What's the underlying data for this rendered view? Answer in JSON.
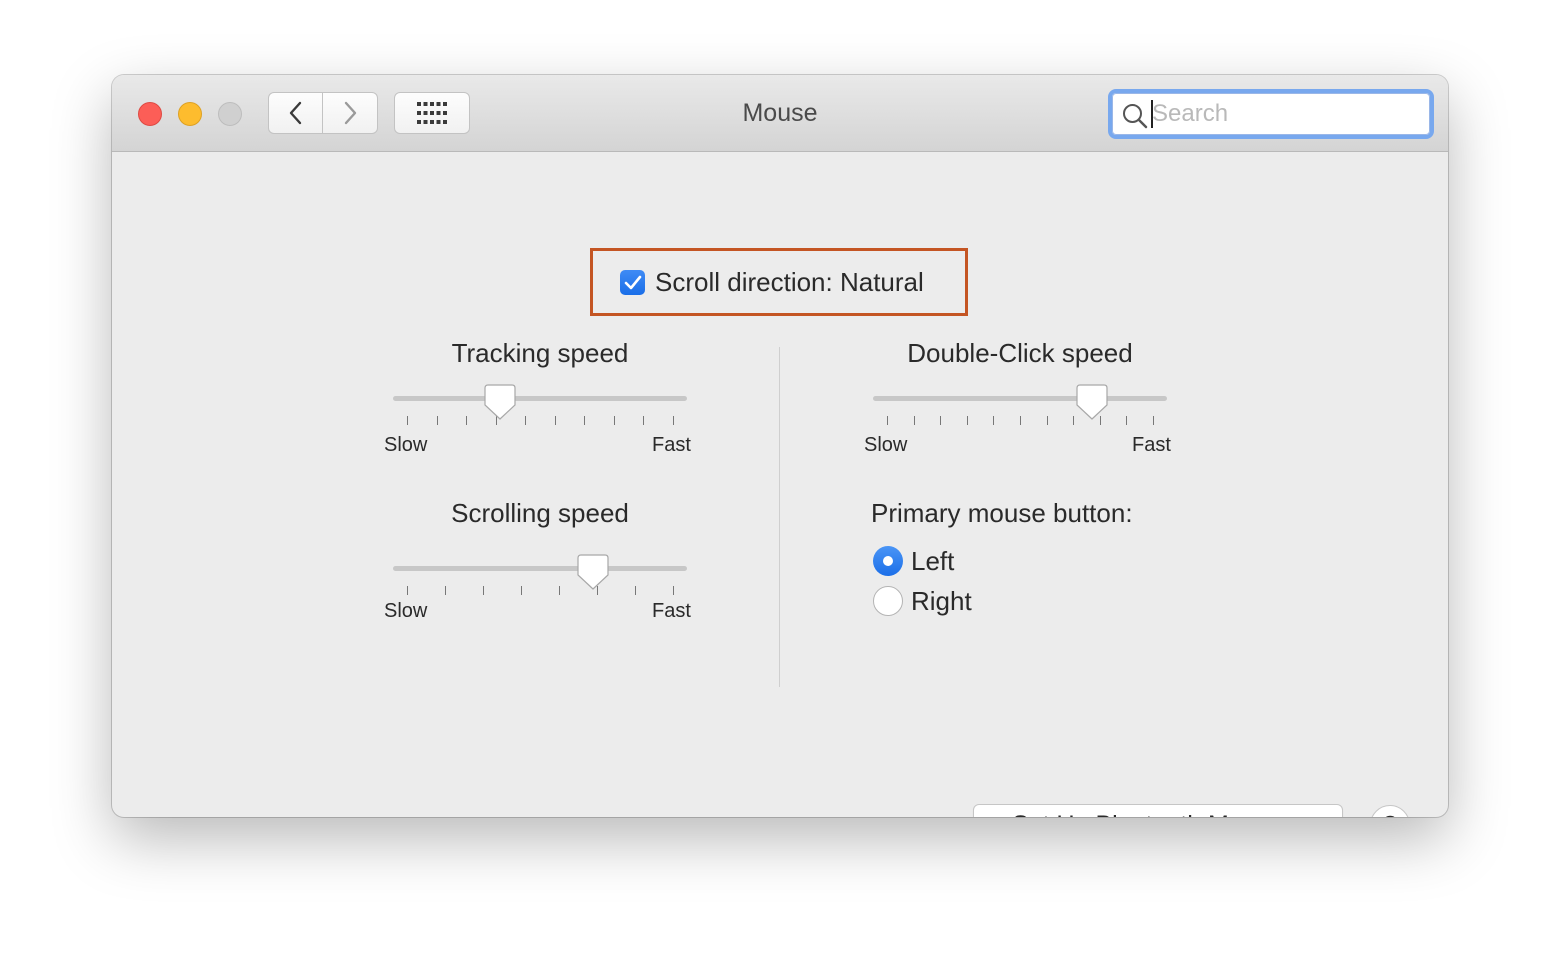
{
  "window": {
    "title": "Mouse",
    "search": {
      "placeholder": "Search",
      "value": ""
    }
  },
  "colors": {
    "accent": "#1c6fe8",
    "highlight_border": "#c45523"
  },
  "options": {
    "scroll_direction": {
      "label": "Scroll direction: Natural",
      "checked": true
    }
  },
  "tracking_speed": {
    "title": "Tracking speed",
    "min_label": "Slow",
    "max_label": "Fast",
    "value": 0.35,
    "ticks": 10
  },
  "scrolling_speed": {
    "title": "Scrolling speed",
    "min_label": "Slow",
    "max_label": "Fast",
    "value": 0.7,
    "ticks": 8
  },
  "double_click_speed": {
    "title": "Double-Click speed",
    "min_label": "Slow",
    "max_label": "Fast",
    "value": 0.77,
    "ticks": 11
  },
  "primary_button": {
    "label": "Primary mouse button:",
    "options": [
      {
        "label": "Left",
        "selected": true
      },
      {
        "label": "Right",
        "selected": false
      }
    ]
  },
  "buttons": {
    "bluetooth": "Set Up Bluetooth Mouse...",
    "help": "?"
  }
}
